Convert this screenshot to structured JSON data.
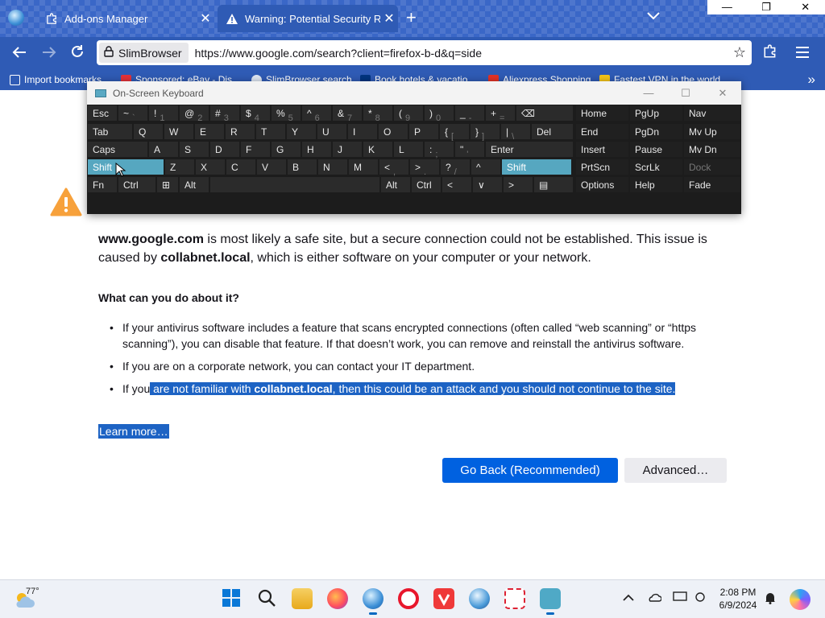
{
  "browser": {
    "tabs": [
      {
        "label": "Add-ons Manager",
        "icon": "puzzle-icon"
      },
      {
        "label": "Warning: Potential Security Risk",
        "icon": "warning-icon"
      }
    ],
    "window_controls": {
      "minimize": "—",
      "restore": "❐",
      "close": "✕"
    }
  },
  "navbar": {
    "identity_label": "SlimBrowser",
    "url": "https://www.google.com/search?client=firefox-b-d&q=side"
  },
  "bookmarks": [
    {
      "label": "Import bookmarks...",
      "color": "#ffffff"
    },
    {
      "label": "Sponsored: eBay - Dis...",
      "color": "#e53238"
    },
    {
      "label": "SlimBrowser search",
      "color": "#dfe7f3"
    },
    {
      "label": "Book hotels & vacatio...",
      "color": "#003580"
    },
    {
      "label": "Aliexpress Shopping",
      "color": "#e43225"
    },
    {
      "label": "Fastest VPN in the world",
      "color": "#f5c518"
    }
  ],
  "page": {
    "description": {
      "site": "www.google.com",
      "text1": " is most likely a safe site, but a secure connection could not be established. This issue is caused by ",
      "issuer": "collabnet.local",
      "text2": ", which is either software on your computer or your network."
    },
    "question": "What can you do about it?",
    "bullets": {
      "b1": "If your antivirus software includes a feature that scans encrypted connections (often called “web scanning” or “https scanning”), you can disable that feature. If that doesn’t work, you can remove and reinstall the antivirus software.",
      "b2": "If you are on a corporate network, you can contact your IT department.",
      "b3_pre": "If you",
      "b3_hl1": " are not familiar with ",
      "b3_hl2": "collabnet.local",
      "b3_hl3": ", then this could be an attack and you should not continue to the site."
    },
    "learn_more": "Learn more…",
    "go_back": "Go Back (Recommended)",
    "advanced": "Advanced…"
  },
  "osk": {
    "title": "On-Screen Keyboard",
    "selected_color": "#56a7c0",
    "rows": [
      [
        "Esc",
        "~",
        "`",
        "!",
        "1",
        "@",
        "2",
        "#",
        "3",
        "$",
        "4",
        "%",
        "5",
        "^",
        "6",
        "&",
        "7",
        "*",
        "8",
        "(",
        "9",
        ")",
        "0",
        "_",
        "-",
        "+",
        "=",
        "⌫",
        "Home",
        "PgUp",
        "Nav"
      ],
      [
        "Tab",
        "Q",
        "W",
        "E",
        "R",
        "T",
        "Y",
        "U",
        "I",
        "O",
        "P",
        "{",
        "[",
        "}",
        "]",
        "|",
        "\\",
        "Del",
        "End",
        "PgDn",
        "Mv Up"
      ],
      [
        "Caps",
        "A",
        "S",
        "D",
        "F",
        "G",
        "H",
        "J",
        "K",
        "L",
        ":",
        ";",
        "\"",
        "'",
        "Enter",
        "Insert",
        "Pause",
        "Mv Dn"
      ],
      [
        "Shift",
        "Z",
        "X",
        "C",
        "V",
        "B",
        "N",
        "M",
        "<",
        ",",
        ">",
        ".",
        "?",
        "/",
        "^",
        "Shift",
        "PrtScn",
        "ScrLk",
        "Dock"
      ],
      [
        "Fn",
        "Ctrl",
        "⊞",
        "Alt",
        "Alt",
        "Ctrl",
        "<",
        "∨",
        ">",
        "▤",
        "Options",
        "Help",
        "Fade"
      ]
    ]
  },
  "taskbar": {
    "weather": "77°",
    "time": "2:08 PM",
    "date": "6/9/2024"
  }
}
